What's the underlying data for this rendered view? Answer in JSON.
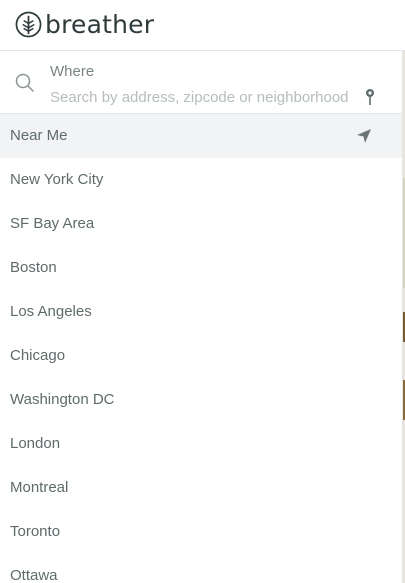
{
  "brand": {
    "name": "breather",
    "logo_icon": "tree-logo-icon"
  },
  "search": {
    "label": "Where",
    "placeholder": "Search by address, zipcode or neighborhood",
    "value": "",
    "icons": {
      "search": "search-icon",
      "pin": "location-pin-icon"
    }
  },
  "near_me": {
    "label": "Near Me",
    "icon": "navigation-arrow-icon"
  },
  "cities": [
    "New York City",
    "SF Bay Area",
    "Boston",
    "Los Angeles",
    "Chicago",
    "Washington DC",
    "London",
    "Montreal",
    "Toronto",
    "Ottawa"
  ],
  "colors": {
    "text": "#5f6b6b",
    "logo": "#2f3b3b",
    "placeholder": "#b6bdbd",
    "highlight": "#f1f3f4",
    "border": "#e3e6e6"
  }
}
